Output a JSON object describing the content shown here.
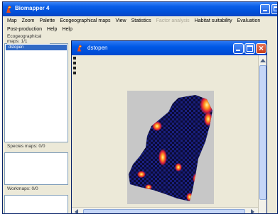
{
  "app": {
    "title": "Biomapper 4",
    "accent": "#0a5ee8"
  },
  "menu": {
    "row1": [
      {
        "label": "Map",
        "enabled": true
      },
      {
        "label": "Zoom",
        "enabled": true
      },
      {
        "label": "Palette",
        "enabled": true
      },
      {
        "label": "Ecogeographical maps",
        "enabled": true
      },
      {
        "label": "View",
        "enabled": true
      },
      {
        "label": "Statistics",
        "enabled": true
      },
      {
        "label": "Factor analysis",
        "enabled": false
      },
      {
        "label": "Habitat suitability",
        "enabled": true
      },
      {
        "label": "Evaluation",
        "enabled": true
      }
    ],
    "row2": [
      {
        "label": "Post-production",
        "enabled": true
      },
      {
        "label": "Help",
        "enabled": true
      },
      {
        "label": "Help",
        "enabled": true
      }
    ]
  },
  "left_panel": {
    "eco_header": "Ecogeographical maps: 1/1",
    "eco_items": [
      "dstopen"
    ],
    "species_header": "Species maps: 0/0",
    "work_header": "Workmaps: 0/0"
  },
  "map_window": {
    "title": "dstopen",
    "icons": [
      "biomapper-app-icon",
      "minimize-icon",
      "maximize-icon",
      "close-icon"
    ]
  }
}
